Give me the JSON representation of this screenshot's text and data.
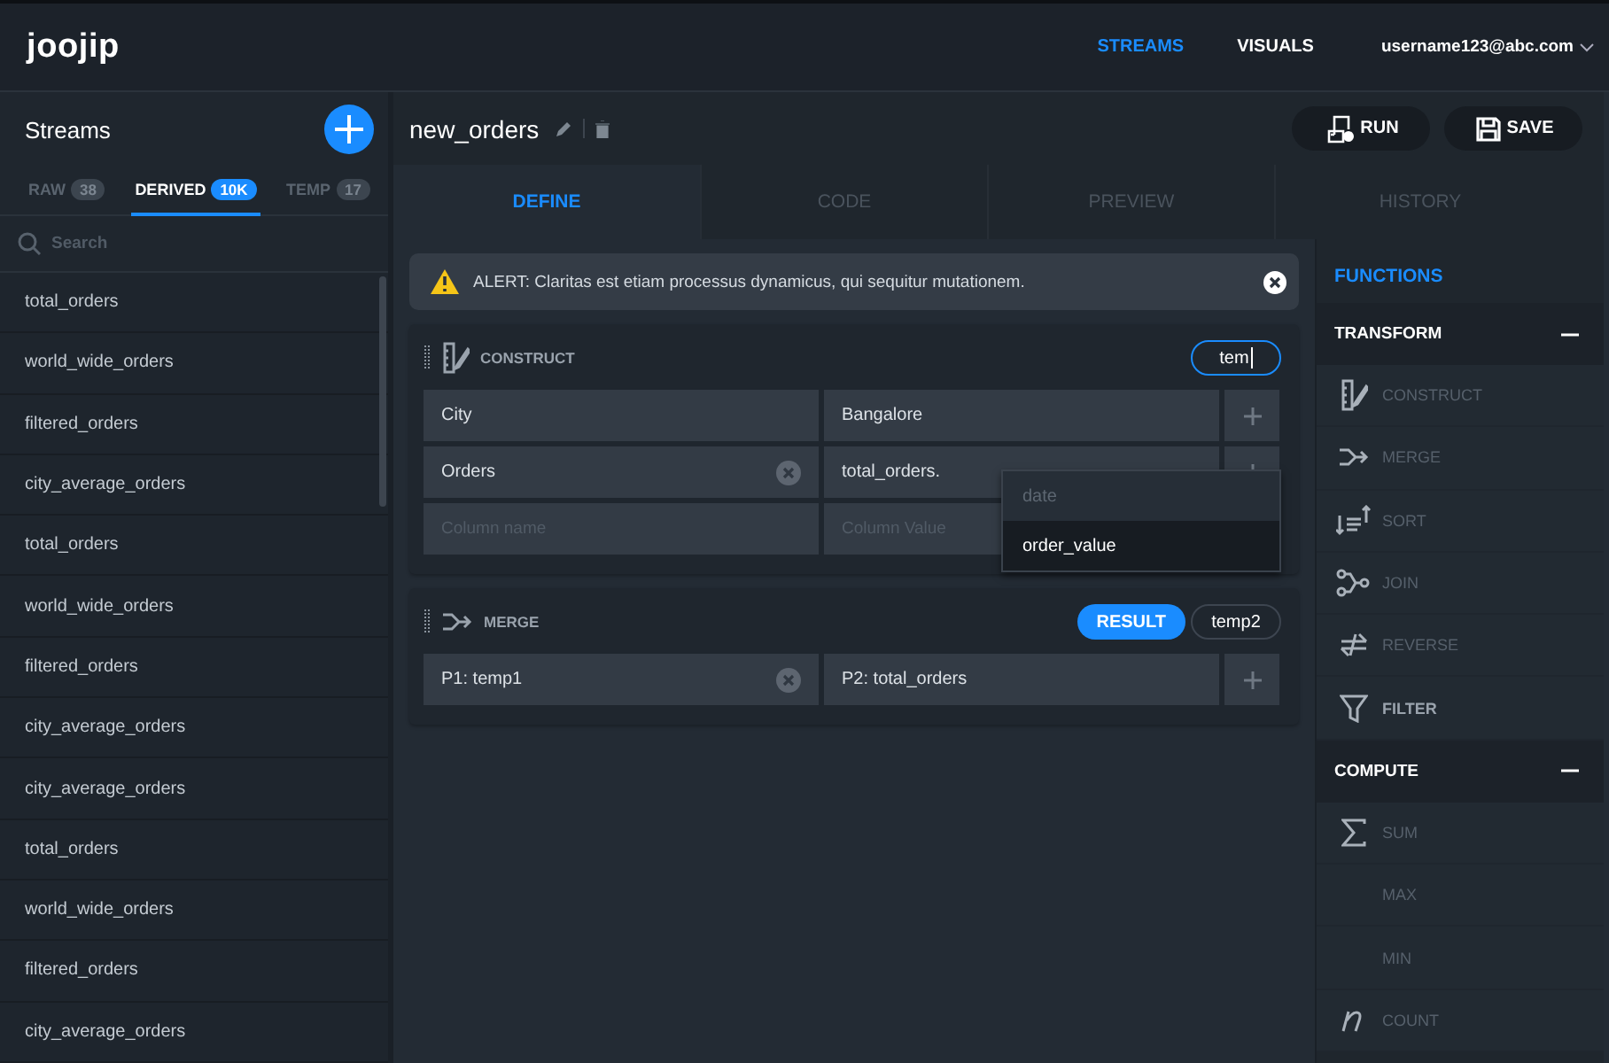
{
  "app": {
    "logo": "joojip"
  },
  "nav": {
    "links": [
      {
        "label": "STREAMS",
        "selected": true
      },
      {
        "label": "VISUALS",
        "selected": false
      }
    ],
    "user": "username123@abc.com"
  },
  "sidebar": {
    "title": "Streams",
    "tabs": [
      {
        "label": "RAW",
        "count": "38",
        "selected": false
      },
      {
        "label": "DERIVED",
        "count": "10K",
        "selected": true
      },
      {
        "label": "TEMP",
        "count": "17",
        "selected": false
      }
    ],
    "search": {
      "placeholder": "Search"
    },
    "streams": [
      "total_orders",
      "world_wide_orders",
      "filtered_orders",
      "city_average_orders",
      "total_orders",
      "world_wide_orders",
      "filtered_orders",
      "city_average_orders",
      "city_average_orders",
      "total_orders",
      "world_wide_orders",
      "filtered_orders",
      "city_average_orders"
    ]
  },
  "editor": {
    "title": "new_orders",
    "actions": [
      {
        "label": "RUN"
      },
      {
        "label": "SAVE"
      }
    ],
    "tabs": [
      {
        "label": "DEFINE",
        "selected": true
      },
      {
        "label": "CODE",
        "selected": false
      },
      {
        "label": "PREVIEW",
        "selected": false
      },
      {
        "label": "HISTORY",
        "selected": false
      }
    ],
    "alert": {
      "text": "ALERT: Claritas est etiam processus dynamicus, qui sequitur mutationem."
    },
    "blocks": [
      {
        "kind": "construct",
        "title": "CONSTRUCT",
        "search": {
          "value": "tem",
          "focused": true
        },
        "rows": [
          {
            "name": "City",
            "value": "Bangalore",
            "clearable": false,
            "add_button": true
          },
          {
            "name": "Orders",
            "value": "total_orders.",
            "clearable": true,
            "add_button": true
          },
          {
            "name_placeholder": "Column name",
            "value_placeholder": "Column Value"
          }
        ],
        "suggestions": [
          {
            "label": "date",
            "selected": false
          },
          {
            "label": "order_value",
            "selected": true
          }
        ]
      },
      {
        "kind": "merge",
        "title": "MERGE",
        "result_button": "RESULT",
        "result_name": "temp2",
        "rows": [
          {
            "name": "P1: temp1",
            "value": "P2: total_orders",
            "clearable": true,
            "add_button": true
          }
        ]
      }
    ]
  },
  "functions": {
    "title": "FUNCTIONS",
    "sections": [
      {
        "title": "TRANSFORM",
        "expanded": true,
        "items": [
          {
            "label": "CONSTRUCT",
            "hovered": false
          },
          {
            "label": "MERGE",
            "hovered": false
          },
          {
            "label": "SORT",
            "hovered": false
          },
          {
            "label": "JOIN",
            "hovered": false
          },
          {
            "label": "REVERSE",
            "hovered": false
          },
          {
            "label": "FILTER",
            "hovered": true
          }
        ]
      },
      {
        "title": "COMPUTE",
        "expanded": true,
        "items": [
          {
            "label": "SUM",
            "hovered": false
          },
          {
            "label": "MAX",
            "hovered": false
          },
          {
            "label": "MIN",
            "hovered": false
          },
          {
            "label": "COUNT",
            "hovered": false
          }
        ]
      }
    ]
  }
}
